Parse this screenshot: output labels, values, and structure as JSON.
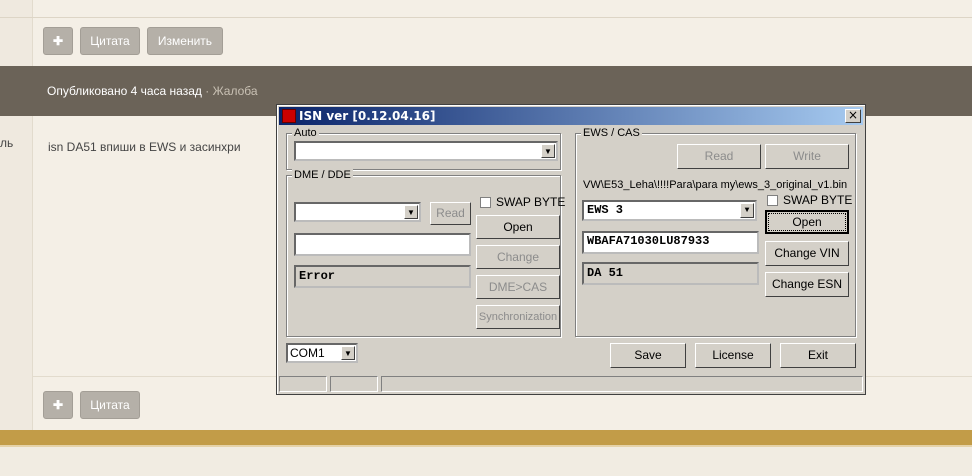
{
  "forum": {
    "top_buttons": {
      "plus": "✚",
      "quote": "Цитата",
      "edit": "Изменить"
    },
    "meta_bar": {
      "published": "Опубликовано 4 часа назад",
      "separator": "·",
      "complaint": "Жалоба"
    },
    "gutter_text": "ль",
    "post_text": "isn DA51 впиши в EWS и засинхри",
    "bottom_buttons": {
      "plus": "✚",
      "quote": "Цитата"
    }
  },
  "window": {
    "title": "ISN ver [0.12.04.16]",
    "close": "×",
    "auto": {
      "label": "Auto",
      "value": ""
    },
    "dme": {
      "label": "DME / DDE",
      "combo_value": "",
      "read": "Read",
      "swap_byte": "SWAP BYTE",
      "input_value": "",
      "status": "Error",
      "open": "Open",
      "change": "Change",
      "dme_cas": "DME>CAS",
      "sync": "Synchronization"
    },
    "ews": {
      "label": "EWS / CAS",
      "read": "Read",
      "write": "Write",
      "path": "VW\\E53_Leha\\!!!!Para\\para my\\ews_3_original_v1.bin",
      "type": "EWS 3",
      "vin": "WBAFA71030LU87933",
      "isn": "DA 51",
      "swap_byte": "SWAP BYTE",
      "open": "Open",
      "change_vin": "Change VIN",
      "change_esn": "Change ESN"
    },
    "com_port": "COM1",
    "save": "Save",
    "license": "License",
    "exit": "Exit"
  }
}
